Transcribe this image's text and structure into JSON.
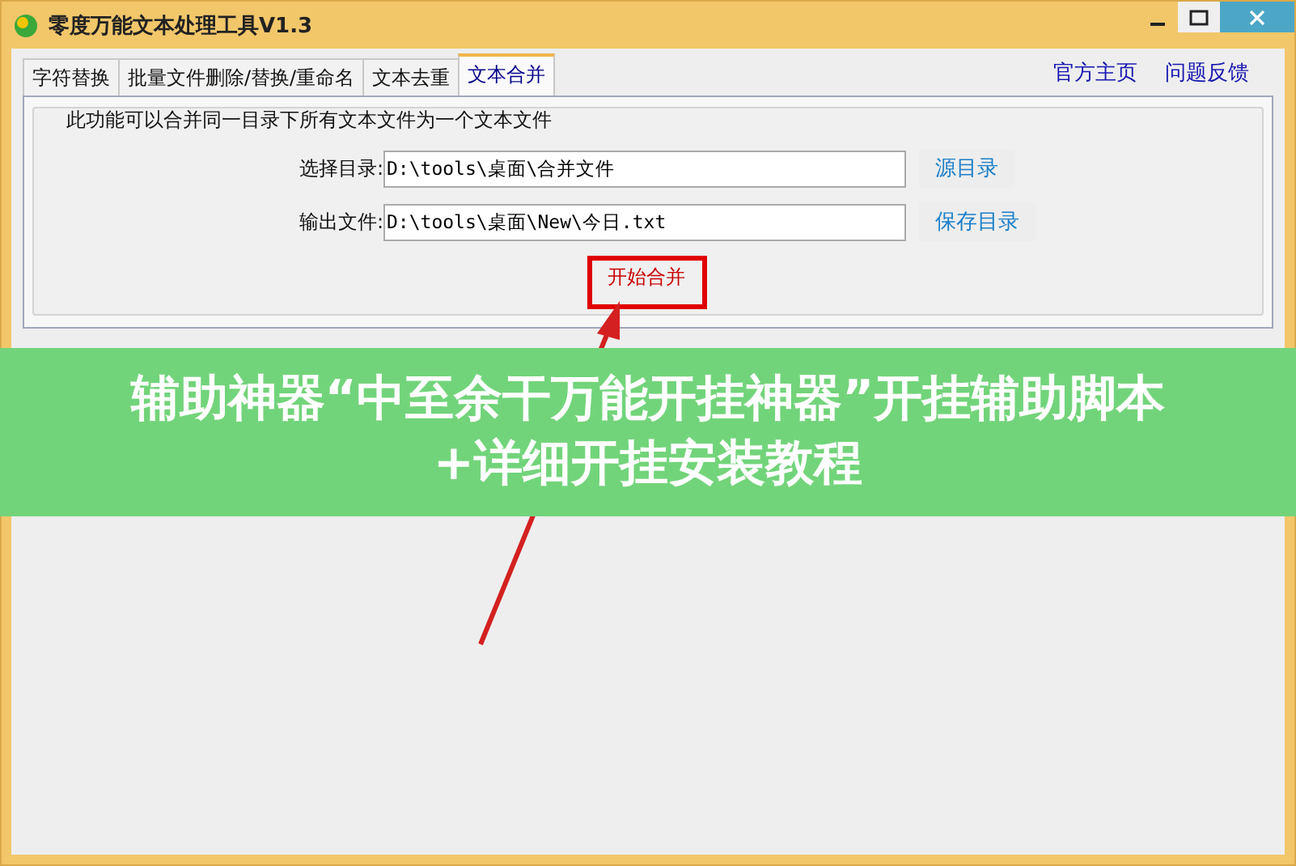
{
  "window": {
    "title": "零度万能文本处理工具V1.3"
  },
  "tabs": [
    {
      "label": "字符替换",
      "selected": false
    },
    {
      "label": "批量文件删除/替换/重命名",
      "selected": false
    },
    {
      "label": "文本去重",
      "selected": false
    },
    {
      "label": "文本合并",
      "selected": true
    }
  ],
  "links": [
    "官方主页",
    "问题反馈"
  ],
  "group": {
    "title": "此功能可以合并同一目录下所有文本文件为一个文本文件"
  },
  "fields": [
    {
      "label": "选择目录:",
      "value": "D:\\tools\\桌面\\合并文件",
      "button": "源目录"
    },
    {
      "label": "输出文件:",
      "value": "D:\\tools\\桌面\\New\\今日.txt",
      "button": "保存目录"
    }
  ],
  "start_button": {
    "label": "开始合并",
    "highlighted": true
  },
  "banner": {
    "text": "辅助神器“中至余干万能开挂神器”开挂辅助脚本+详细开挂安装教程"
  }
}
